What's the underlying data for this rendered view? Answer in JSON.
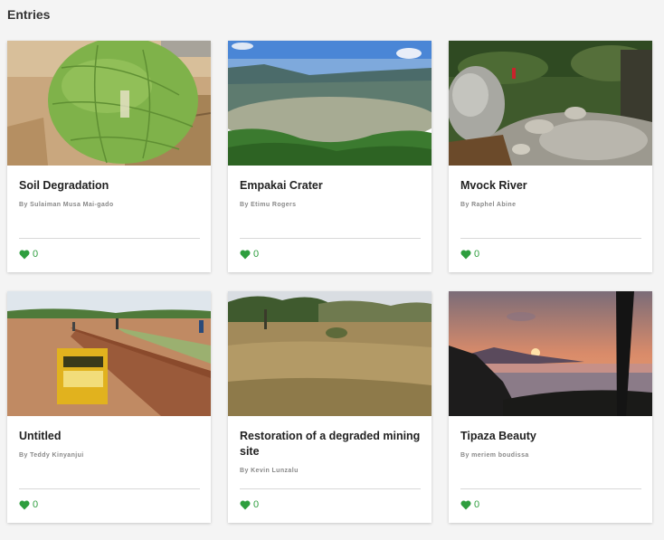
{
  "header": {
    "title": "Entries"
  },
  "entries": [
    {
      "title": "Soil Degradation",
      "author": "By Sulaiman Musa Mai-gado",
      "likes": "0",
      "image": "watermelon-photo"
    },
    {
      "title": "Empakai Crater",
      "author": "By Etimu Rogers",
      "likes": "0",
      "image": "crater-lake-photo"
    },
    {
      "title": "Mvock River",
      "author": "By Raphel Abine",
      "likes": "0",
      "image": "rocky-river-photo"
    },
    {
      "title": "Untitled",
      "author": "By Teddy Kinyanjui",
      "likes": "0",
      "image": "seedballs-field-photo"
    },
    {
      "title": "Restoration of a degraded mining site",
      "author": "By Kevin Lunzalu",
      "likes": "0",
      "image": "savanna-field-photo"
    },
    {
      "title": "Tipaza Beauty",
      "author": "By meriem boudissa",
      "likes": "0",
      "image": "coastal-sunset-photo"
    }
  ],
  "like_color": "#2e9e3e"
}
